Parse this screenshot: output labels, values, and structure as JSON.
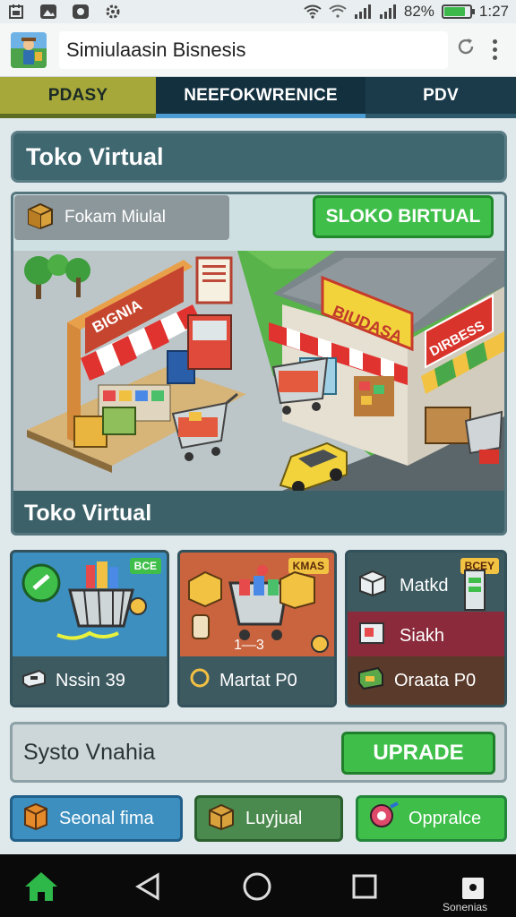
{
  "status_bar": {
    "battery_percent": "82%",
    "battery_level": 0.82,
    "time": "1:27"
  },
  "app_bar": {
    "title": "Simiulaasin Bisnesis"
  },
  "tabs": [
    {
      "label": "PDASY",
      "selected": false
    },
    {
      "label": "NEEFOKWRENICE",
      "selected": true
    },
    {
      "label": "PDV",
      "selected": false
    }
  ],
  "header": {
    "title": "Toko Virtual"
  },
  "store": {
    "mode_label": "Fokam Miulal",
    "button_label": "SLOKO BIRTUAL",
    "scene_signs": [
      "BIGNIA",
      "BIUDASA",
      "DIRBESS"
    ],
    "caption": "Toko Virtual"
  },
  "tiles": [
    {
      "badge": "BCE",
      "footer": "Nssin 39"
    },
    {
      "badge": "KMAS",
      "counter": "1—3",
      "footer": "Martat P0"
    },
    {
      "badge": "BCEY",
      "rows": [
        "Matkd",
        "Siakh",
        "Oraata P0"
      ]
    }
  ],
  "system": {
    "label": "Systo Vnahia",
    "button_label": "UPRADE"
  },
  "actions": [
    {
      "label": "Seonal fima"
    },
    {
      "label": "Luyjual"
    },
    {
      "label": "Oppralce"
    }
  ],
  "navbar": {
    "extra_label": "Sonenias"
  },
  "colors": {
    "accent_green": "#3fbf4a",
    "tab_selected_bg": "#13303f",
    "tab_selected_underline": "#4b9cd3",
    "panel": "#3f6770"
  }
}
